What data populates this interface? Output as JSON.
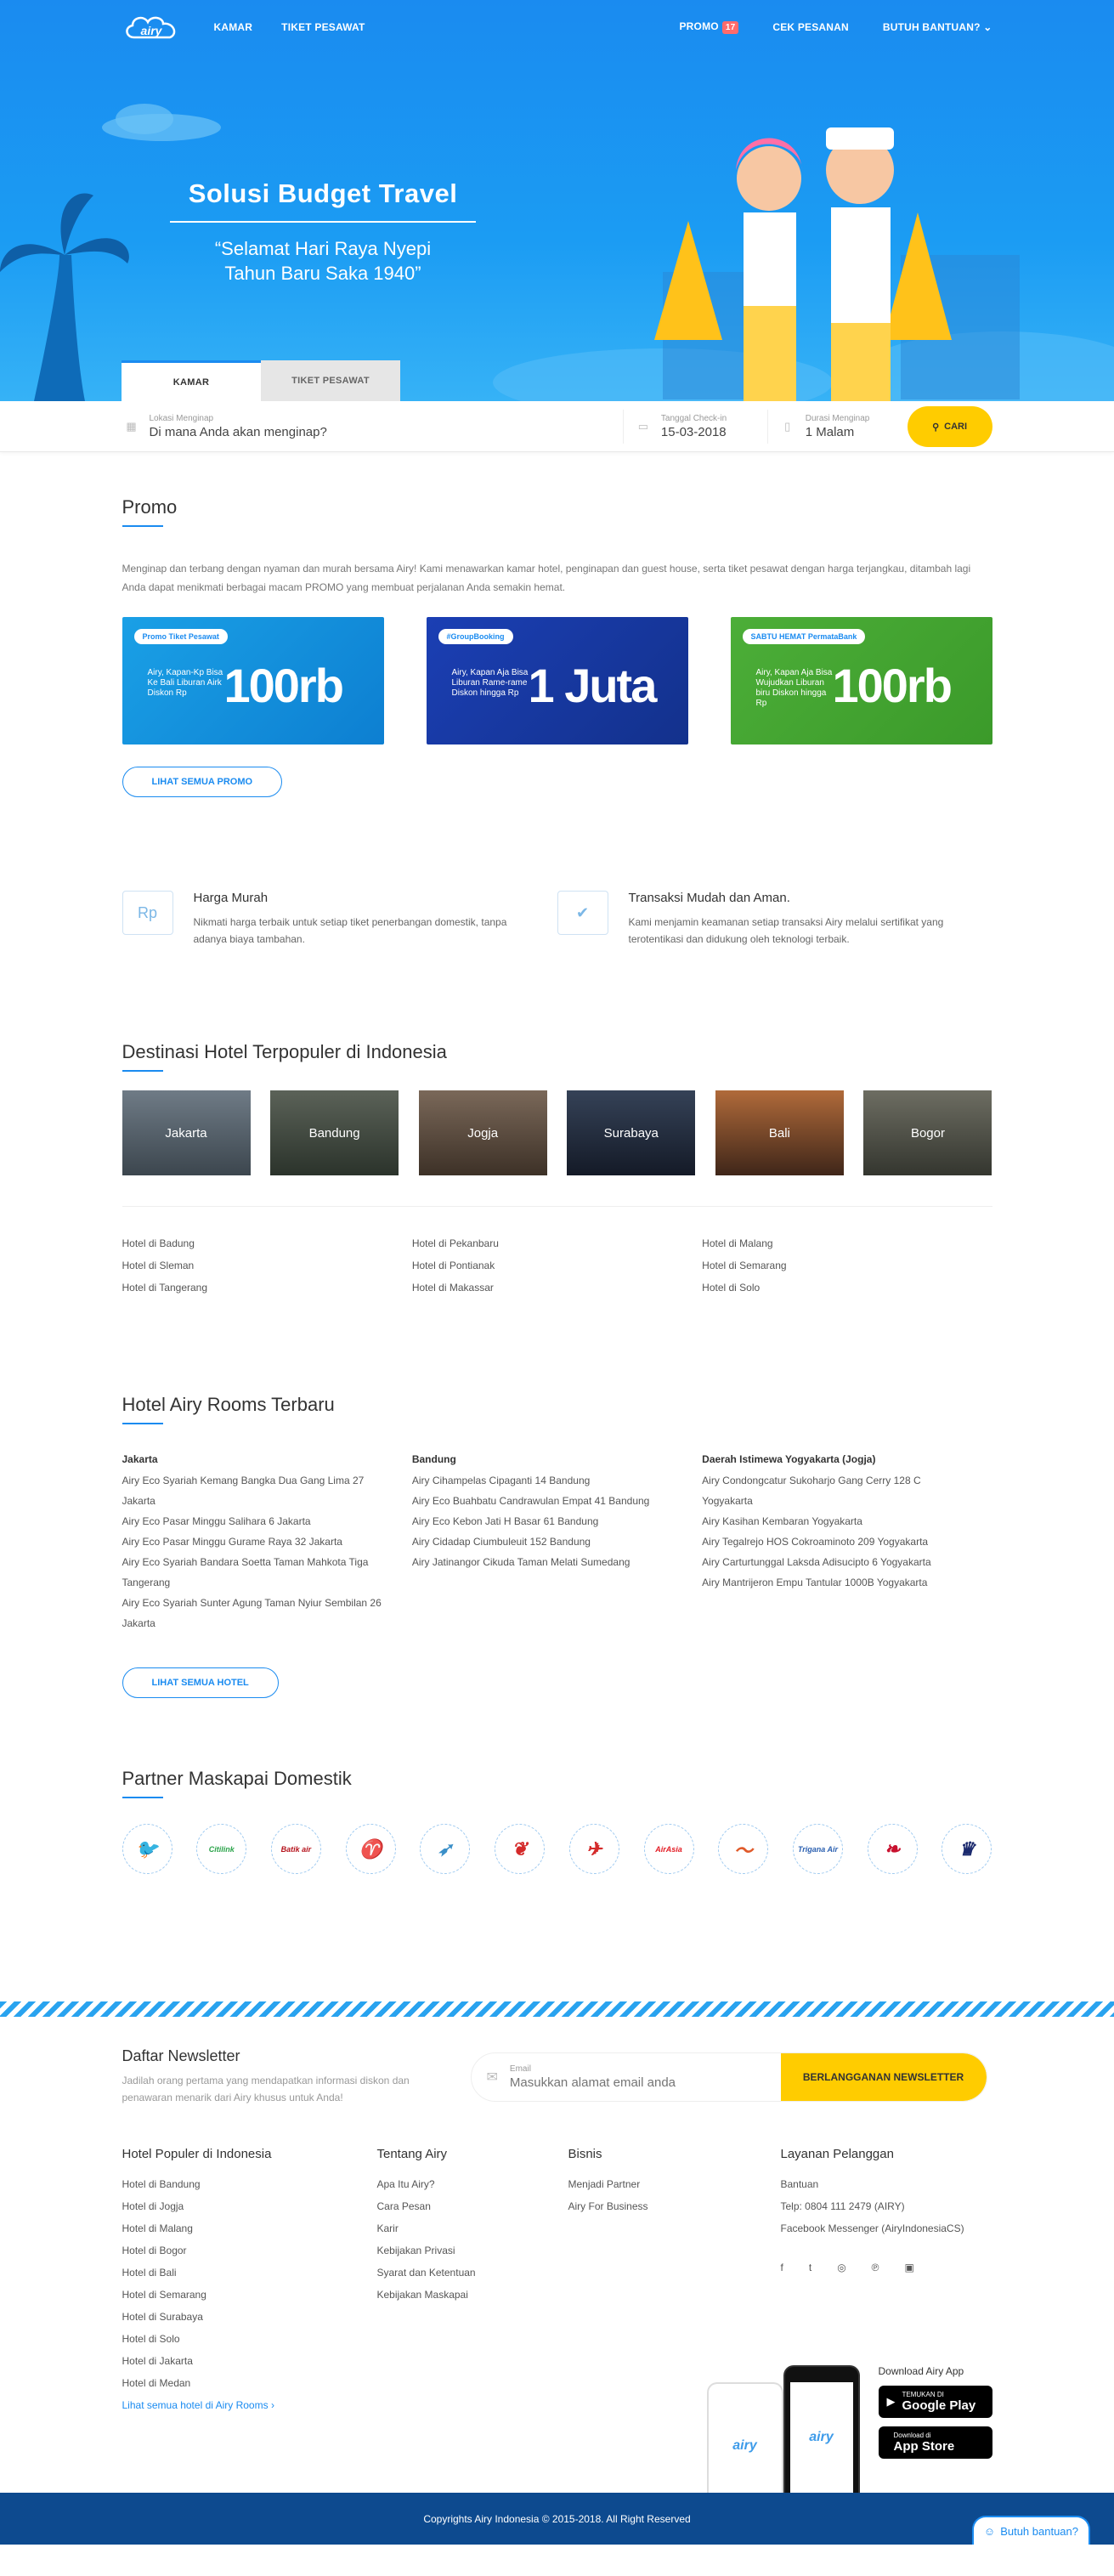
{
  "header": {
    "logo_text": "airy",
    "nav_left": [
      "KAMAR",
      "TIKET PESAWAT"
    ],
    "promo_label": "PROMO",
    "promo_count": "17",
    "cek_pesanan": "CEK PESANAN",
    "bantuan": "BUTUH BANTUAN?"
  },
  "hero": {
    "title": "Solusi Budget Travel",
    "subtitle_1": "“Selamat Hari Raya Nyepi",
    "subtitle_2": "Tahun Baru Saka 1940”",
    "tabs": [
      "KAMAR",
      "TIKET PESAWAT"
    ]
  },
  "search": {
    "location_label": "Lokasi Menginap",
    "location_placeholder": "Di mana Anda akan menginap?",
    "checkin_label": "Tanggal Check-in",
    "checkin_value": "15-03-2018",
    "duration_label": "Durasi Menginap",
    "duration_value": "1 Malam",
    "button": "CARI"
  },
  "promo": {
    "title": "Promo",
    "description": "Menginap dan terbang dengan nyaman dan murah bersama Airy! Kami menawarkan kamar hotel, penginapan dan guest house, serta tiket pesawat dengan harga terjangkau, ditambah lagi Anda dapat menikmati berbagai macam PROMO yang membuat perjalanan Anda semakin hemat.",
    "cards": [
      {
        "tag": "Promo Tiket Pesawat",
        "small": "Airy, Kapan-Kp Bisa Ke Bali Liburan Airk Diskon Rp",
        "big": "100rb"
      },
      {
        "tag": "#GroupBooking",
        "small": "Airy, Kapan Aja Bisa Liburan Rame-rame Diskon hingga Rp",
        "big": "1 Juta"
      },
      {
        "tag": "SABTU HEMAT PermataBank",
        "small": "Airy, Kapan Aja Bisa Wujudkan Liburan biru Diskon hingga Rp",
        "big": "100rb"
      }
    ],
    "button": "LIHAT SEMUA PROMO"
  },
  "features": [
    {
      "icon": "price-tag-icon",
      "title": "Harga Murah",
      "text": "Nikmati harga terbaik untuk setiap tiket penerbangan domestik, tanpa adanya biaya tambahan."
    },
    {
      "icon": "shield-check-icon",
      "title": "Transaksi Mudah dan Aman.",
      "text": "Kami menjamin keamanan setiap transaksi Airy melalui sertifikat yang terotentikasi dan didukung oleh teknologi terbaik."
    }
  ],
  "destinations": {
    "title": "Destinasi Hotel Terpopuler di Indonesia",
    "cities": [
      "Jakarta",
      "Bandung",
      "Jogja",
      "Surabaya",
      "Bali",
      "Bogor"
    ],
    "links": [
      [
        "Hotel di Badung",
        "Hotel di Sleman",
        "Hotel di Tangerang"
      ],
      [
        "Hotel di Pekanbaru",
        "Hotel di Pontianak",
        "Hotel di Makassar"
      ],
      [
        "Hotel di Malang",
        "Hotel di Semarang",
        "Hotel di Solo"
      ]
    ]
  },
  "rooms": {
    "title": "Hotel Airy Rooms Terbaru",
    "columns": [
      {
        "city": "Jakarta",
        "items": [
          "Airy Eco Syariah Kemang Bangka Dua Gang Lima 27 Jakarta",
          "Airy Eco Pasar Minggu Salihara 6 Jakarta",
          "Airy Eco Pasar Minggu Gurame Raya 32 Jakarta",
          "Airy Eco Syariah Bandara Soetta Taman Mahkota Tiga Tangerang",
          "Airy Eco Syariah Sunter Agung Taman Nyiur Sembilan 26 Jakarta"
        ]
      },
      {
        "city": "Bandung",
        "items": [
          "Airy Cihampelas Cipaganti 14 Bandung",
          "Airy Eco Buahbatu Candrawulan Empat 41 Bandung",
          "Airy Eco Kebon Jati H Basar 61 Bandung",
          "Airy Cidadap Ciumbuleuit 152 Bandung",
          "Airy Jatinangor Cikuda Taman Melati Sumedang"
        ]
      },
      {
        "city": "Daerah Istimewa Yogyakarta (Jogja)",
        "items": [
          "Airy Condongcatur Sukoharjo Gang Cerry 128 C Yogyakarta",
          "Airy Kasihan Kembaran Yogyakarta",
          "Airy Tegalrejo HOS Cokroaminoto 209 Yogyakarta",
          "Airy Carturtunggal Laksda Adisucipto 6 Yogyakarta",
          "Airy Mantrijeron Empu Tantular 1000B Yogyakarta"
        ]
      }
    ],
    "button": "LIHAT SEMUA HOTEL"
  },
  "airlines": {
    "title": "Partner Maskapai Domestik",
    "logos": [
      {
        "name": "garuda-bird-icon",
        "glyph": "🐦",
        "color": "#d5252a"
      },
      {
        "name": "citilink-icon",
        "glyph": "Citilink",
        "color": "#2aa34a"
      },
      {
        "name": "batik-air-icon",
        "glyph": "Batik air",
        "color": "#b5121b"
      },
      {
        "name": "sriwijaya-icon",
        "glyph": "♈",
        "color": "#c8a04a"
      },
      {
        "name": "garuda-indonesia-icon",
        "glyph": "➶",
        "color": "#3a8fc8"
      },
      {
        "name": "lion-air-icon",
        "glyph": "❦",
        "color": "#d42a2a"
      },
      {
        "name": "wings-air-icon",
        "glyph": "✈",
        "color": "#d42a2a"
      },
      {
        "name": "airasia-icon",
        "glyph": "AirAsia",
        "color": "#e31b23"
      },
      {
        "name": "kalstar-icon",
        "glyph": "〜",
        "color": "#e05a2a"
      },
      {
        "name": "trigana-air-icon",
        "glyph": "Trigana Air",
        "color": "#2a5fb0"
      },
      {
        "name": "transnusa-icon",
        "glyph": "❧",
        "color": "#c8102e"
      },
      {
        "name": "xpress-air-icon",
        "glyph": "♛",
        "color": "#1b2a6e"
      }
    ]
  },
  "footer": {
    "newsletter_title": "Daftar Newsletter",
    "newsletter_text": "Jadilah orang pertama yang mendapatkan informasi diskon dan penawaran menarik dari Airy khusus untuk Anda!",
    "email_label": "Email",
    "email_placeholder": "Masukkan alamat email anda",
    "subscribe_button": "BERLANGGANAN NEWSLETTER",
    "col1_title": "Hotel Populer di Indonesia",
    "col1_links": [
      "Hotel di Bandung",
      "Hotel di Jogja",
      "Hotel di Malang",
      "Hotel di Bogor",
      "Hotel di Bali",
      "Hotel di Semarang",
      "Hotel di Surabaya",
      "Hotel di Solo",
      "Hotel di Jakarta",
      "Hotel di Medan"
    ],
    "col1_more": "Lihat semua hotel di Airy Rooms",
    "col2_title": "Tentang Airy",
    "col2_links": [
      "Apa Itu Airy?",
      "Cara Pesan",
      "Karir",
      "Kebijakan Privasi",
      "Syarat dan Ketentuan",
      "Kebijakan Maskapai"
    ],
    "col3_title": "Bisnis",
    "col3_links": [
      "Menjadi Partner",
      "Airy For Business"
    ],
    "col4_title": "Layanan Pelanggan",
    "col4_lines": [
      "Bantuan",
      "Telp: 0804 111 2479 (AIRY)",
      "Facebook Messenger (AiryIndonesiaCS)"
    ],
    "social": [
      "facebook-icon",
      "twitter-icon",
      "instagram-icon",
      "pinterest-icon",
      "blog-icon"
    ],
    "download_title": "Download Airy App",
    "google_small": "TEMUKAN DI",
    "google_big": "Google Play",
    "apple_small": "Download di",
    "apple_big": "App Store",
    "phone_logo": "airy",
    "copyright": "Copyrights Airy Indonesia © 2015-2018. All Right Reserved",
    "help_button": "Butuh bantuan?"
  }
}
